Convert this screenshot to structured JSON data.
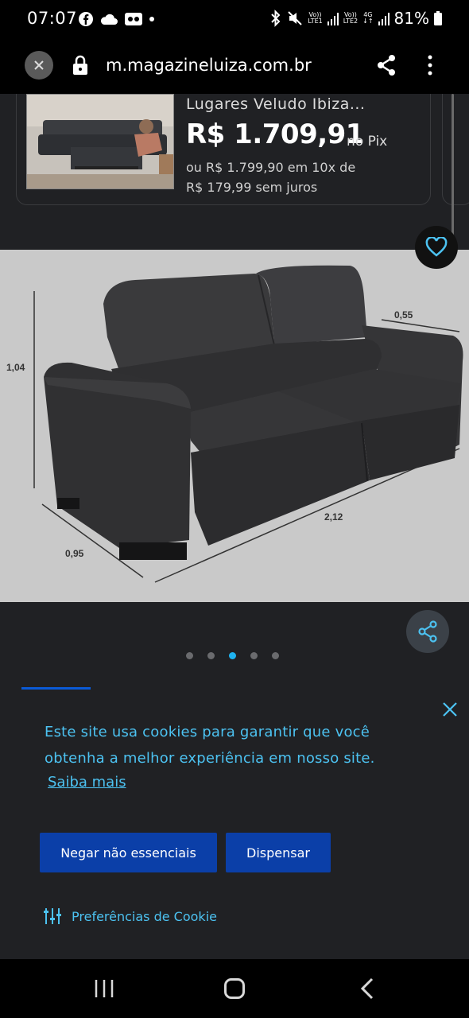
{
  "status_bar": {
    "time": "07:07",
    "battery": "81%",
    "net1_top": "Vo))",
    "net1_bottom": "LTE1",
    "net2_top": "Vo))",
    "net2_bottom": "LTE2",
    "net_type": "4G"
  },
  "browser": {
    "url": "m.magazineluiza.com.br"
  },
  "product_card": {
    "title": "Lugares Veludo Ibiza...",
    "price": "R$ 1.709,91",
    "price_suffix": "no Pix",
    "installments_line1": "ou R$ 1.799,90 em 10x de",
    "installments_line2": "R$ 179,99 sem juros"
  },
  "gallery": {
    "dimension_height": "1,04",
    "dimension_depth_top": "0,55",
    "dimension_width": "2,12",
    "dimension_depth_bottom": "0,95",
    "dots_total": 5,
    "active_dot": 3
  },
  "cookie_banner": {
    "message": "Este site usa cookies para garantir que você obtenha a melhor experiência em nosso site.",
    "learn_more": "Saiba mais",
    "deny_button": "Negar não essenciais",
    "dismiss_button": "Dispensar",
    "preferences": "Preferências de Cookie"
  },
  "colors": {
    "accent_blue": "#0b3fa8",
    "link_cyan": "#4cc2f1",
    "active_dot": "#1fb3f0"
  }
}
